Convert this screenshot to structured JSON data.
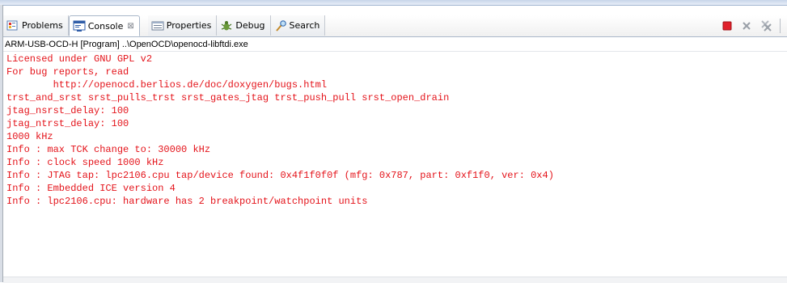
{
  "tabs": [
    {
      "label": "Problems",
      "icon": "problems-icon",
      "active": false
    },
    {
      "label": "Console",
      "icon": "console-icon",
      "active": true,
      "close_glyph": "⊠"
    },
    {
      "label": "Properties",
      "icon": "properties-icon",
      "active": false
    },
    {
      "label": "Debug",
      "icon": "debug-icon",
      "active": false
    },
    {
      "label": "Search",
      "icon": "search-icon",
      "active": false
    }
  ],
  "toolbar": {
    "buttons": [
      "terminate-icon",
      "remove-launch-icon",
      "remove-all-terminated-icon"
    ]
  },
  "console": {
    "title": "ARM-USB-OCD-H [Program] ..\\OpenOCD\\openocd-libftdi.exe",
    "lines": [
      "Licensed under GNU GPL v2",
      "For bug reports, read",
      "        http://openocd.berlios.de/doc/doxygen/bugs.html",
      "trst_and_srst srst_pulls_trst srst_gates_jtag trst_push_pull srst_open_drain",
      "jtag_nsrst_delay: 100",
      "jtag_ntrst_delay: 100",
      "1000 kHz",
      "Info : max TCK change to: 30000 kHz",
      "Info : clock speed 1000 kHz",
      "Info : JTAG tap: lpc2106.cpu tap/device found: 0x4f1f0f0f (mfg: 0x787, part: 0xf1f0, ver: 0x4)",
      "Info : Embedded ICE version 4",
      "Info : lpc2106.cpu: hardware has 2 breakpoint/watchpoint units"
    ],
    "text_color": "#e4131a"
  }
}
